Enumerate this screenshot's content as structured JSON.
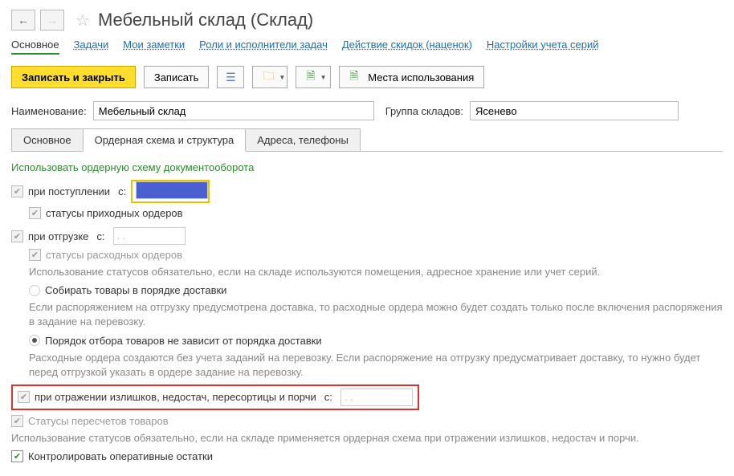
{
  "header": {
    "title": "Мебельный склад (Склад)"
  },
  "nav": {
    "main": "Основное",
    "tasks": "Задачи",
    "notes": "Мои заметки",
    "roles": "Роли и исполнители задач",
    "discounts": "Действие скидок (наценок)",
    "series": "Настройки учета серий"
  },
  "toolbar": {
    "save_close": "Записать и закрыть",
    "save": "Записать",
    "usage": "Места использования"
  },
  "fields": {
    "name_label": "Наименование:",
    "name_value": "Мебельный склад",
    "group_label": "Группа складов:",
    "group_value": "Ясенево"
  },
  "tabs": {
    "t1": "Основное",
    "t2": "Ордерная схема и структура",
    "t3": "Адреса, телефоны"
  },
  "ord": {
    "section": "Использовать ордерную схему документооборота",
    "on_receipt": "при поступлении",
    "from_label": "с:",
    "from_label2": "с:",
    "from_label3": "с:",
    "receipt_statuses": "статусы приходных ордеров",
    "on_ship": "при отгрузке",
    "ship_statuses": "статусы расходных ордеров",
    "hint_statuses": "Использование статусов обязательно, если на складе используются помещения, адресное хранение или учет серий.",
    "radio_collect": "Собирать товары в порядке доставки",
    "hint_collect": "Если распоряжением на отгрузку предусмотрена доставка, то расходные ордера можно будет создать только после включения распоряжения в задание на перевозку.",
    "radio_order": "Порядок отбора товаров не зависит от порядка доставки",
    "hint_order": "Расходные ордера создаются без учета заданий на перевозку. Если распоряжение на отгрузку предусматривает доставку, то нужно будет перед отгрузкой указать в ордере задание на перевозку.",
    "on_surplus": "при отражении излишков, недостач, пересортицы и порчи",
    "recount_statuses": "Статусы пересчетов товаров",
    "hint_recount": "Использование статусов обязательно, если на складе применяется ордерная схема при отражении излишков, недостач и порчи.",
    "control": "Контролировать оперативные остатки",
    "date_placeholder": ". .",
    "date_placeholder2": ". .",
    "date_placeholder3": ". ."
  }
}
